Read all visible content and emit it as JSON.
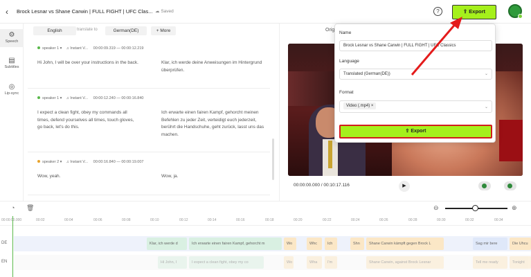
{
  "header": {
    "title": "Brock Lesnar vs Shane Carwin | FULL FIGHT | UFC Clas...",
    "saved": "Saved",
    "export_label": "Export"
  },
  "leftnav": [
    {
      "label": "Speech",
      "icon": "speech-icon"
    },
    {
      "label": "Subtitles",
      "icon": "subtitles-icon"
    },
    {
      "label": "Lip-sync",
      "icon": "lipsync-icon"
    }
  ],
  "langbar": {
    "source": "English",
    "translate_to": "translate to",
    "target": "German(DE)",
    "more": "+ More"
  },
  "segments": [
    {
      "speaker": "speaker 1",
      "voice": "Instant V...",
      "start": "00:00:09.319",
      "end": "00:00:12.219",
      "src": "Hi John, I will be over your instructions in the back.",
      "tgt": "Klar, ich werde deine Anweisungen im Hintergrund überprüfen.",
      "dot": "#59b84a"
    },
    {
      "speaker": "speaker 1",
      "voice": "Instant V...",
      "start": "00:00:12.240",
      "end": "00:00:16.840",
      "src": "I expect a clean fight, obey my commands all times, defend yourselves all times, touch gloves, go back, let's do this.",
      "tgt": "Ich erwarte einen fairen Kampf, gehorcht meinen Befehlen zu jeder Zeit, verteidigt euch jederzeit, berührt die Handschuhe, geht zurück, lasst uns das machen.",
      "dot": "#59b84a"
    },
    {
      "speaker": "speaker 2",
      "voice": "Instant V...",
      "start": "00:00:16.840",
      "end": "00:00:19.007",
      "src": "Wow, yeah.",
      "tgt": "Wow, ja.",
      "dot": "#e8a32b"
    }
  ],
  "preview": {
    "tab": "Orig",
    "time": "00:00:00.000 / 00:10:17.116"
  },
  "timeline": {
    "ticks": [
      "00:00:00.000",
      "00:02",
      "00:04",
      "00:06",
      "00:08",
      "00:10",
      "00:12",
      "00:14",
      "00:16",
      "00:18",
      "00:20",
      "00:22",
      "00:24",
      "00:26",
      "00:28",
      "00:30",
      "00:32",
      "00:34"
    ],
    "tracks": [
      "DE",
      "EN"
    ],
    "de_clips": [
      "Klar, ich werde d",
      "Ich erwarte einen fairen Kampf, gehorcht m",
      "Wo",
      "Whc",
      "Ich",
      "Shn",
      "Shane Carwin kämpft gegen Brock L",
      "Sag mir bere",
      "Die Uhcu"
    ],
    "en_clips": [
      "Hi John, I",
      "I expect a clean fight, obey my co",
      "Wo",
      "Wha",
      "I'm",
      "Shane Carwin, against Brock Lesnar",
      "Tell me ready",
      "Tonight"
    ]
  },
  "popup": {
    "name_label": "Name",
    "name_value": "Brock Lesnar vs Shane Carwin | FULL FIGHT | UFC Classics",
    "language_label": "Language",
    "language_value": "Translated (German(DE))",
    "format_label": "Format",
    "format_value": "Video (.mp4)",
    "export_label": "Export"
  },
  "colors": {
    "accent": "#a5f01c",
    "highlight": "#d11c1c"
  }
}
